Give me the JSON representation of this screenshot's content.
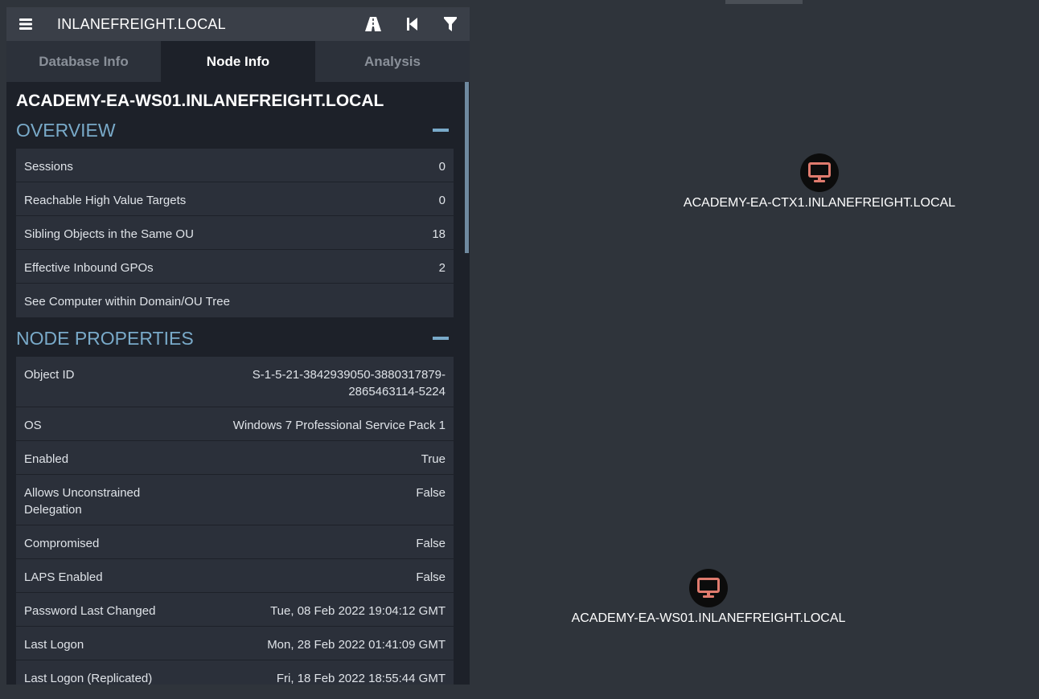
{
  "header": {
    "title": "INLANEFREIGHT.LOCAL",
    "icons": [
      "menu-icon",
      "pathfinding-icon",
      "back-icon",
      "filter-icon"
    ]
  },
  "tabs": [
    {
      "label": "Database Info",
      "active": false
    },
    {
      "label": "Node Info",
      "active": true
    },
    {
      "label": "Analysis",
      "active": false
    }
  ],
  "node_name": "ACADEMY-EA-WS01.INLANEFREIGHT.LOCAL",
  "overview": {
    "heading": "OVERVIEW",
    "rows": [
      {
        "label": "Sessions",
        "value": "0"
      },
      {
        "label": "Reachable High Value Targets",
        "value": "0"
      },
      {
        "label": "Sibling Objects in the Same OU",
        "value": "18"
      },
      {
        "label": "Effective Inbound GPOs",
        "value": "2"
      },
      {
        "label": "See Computer within Domain/OU Tree",
        "value": ""
      }
    ]
  },
  "properties": {
    "heading": "NODE PROPERTIES",
    "object_id": {
      "label": "Object ID",
      "value_line1": "S-1-5-21-3842939050-3880317879-",
      "value_line2": "2865463114-5224"
    },
    "os": {
      "label": "OS",
      "value": "Windows 7 Professional Service Pack 1"
    },
    "enabled": {
      "label": "Enabled",
      "value": "True"
    },
    "unconstrained": {
      "label_line1": "Allows Unconstrained",
      "label_line2": "Delegation",
      "value": "False"
    },
    "compromised": {
      "label": "Compromised",
      "value": "False"
    },
    "laps": {
      "label": "LAPS Enabled",
      "value": "False"
    },
    "pwd_last_changed": {
      "label": "Password Last Changed",
      "value": "Tue, 08 Feb 2022 19:04:12 GMT"
    },
    "last_logon": {
      "label": "Last Logon",
      "value": "Mon, 28 Feb 2022 01:41:09 GMT"
    },
    "last_logon_repl": {
      "label": "Last Logon (Replicated)",
      "value": "Fri, 18 Feb 2022 18:55:44 GMT"
    }
  },
  "graph": {
    "nodes": [
      {
        "label": "ACADEMY-EA-CTX1.INLANEFREIGHT.LOCAL",
        "icon": "computer-icon"
      },
      {
        "label": "ACADEMY-EA-WS01.INLANEFREIGHT.LOCAL",
        "icon": "computer-icon"
      }
    ],
    "icon_color": "#e07b6e"
  }
}
